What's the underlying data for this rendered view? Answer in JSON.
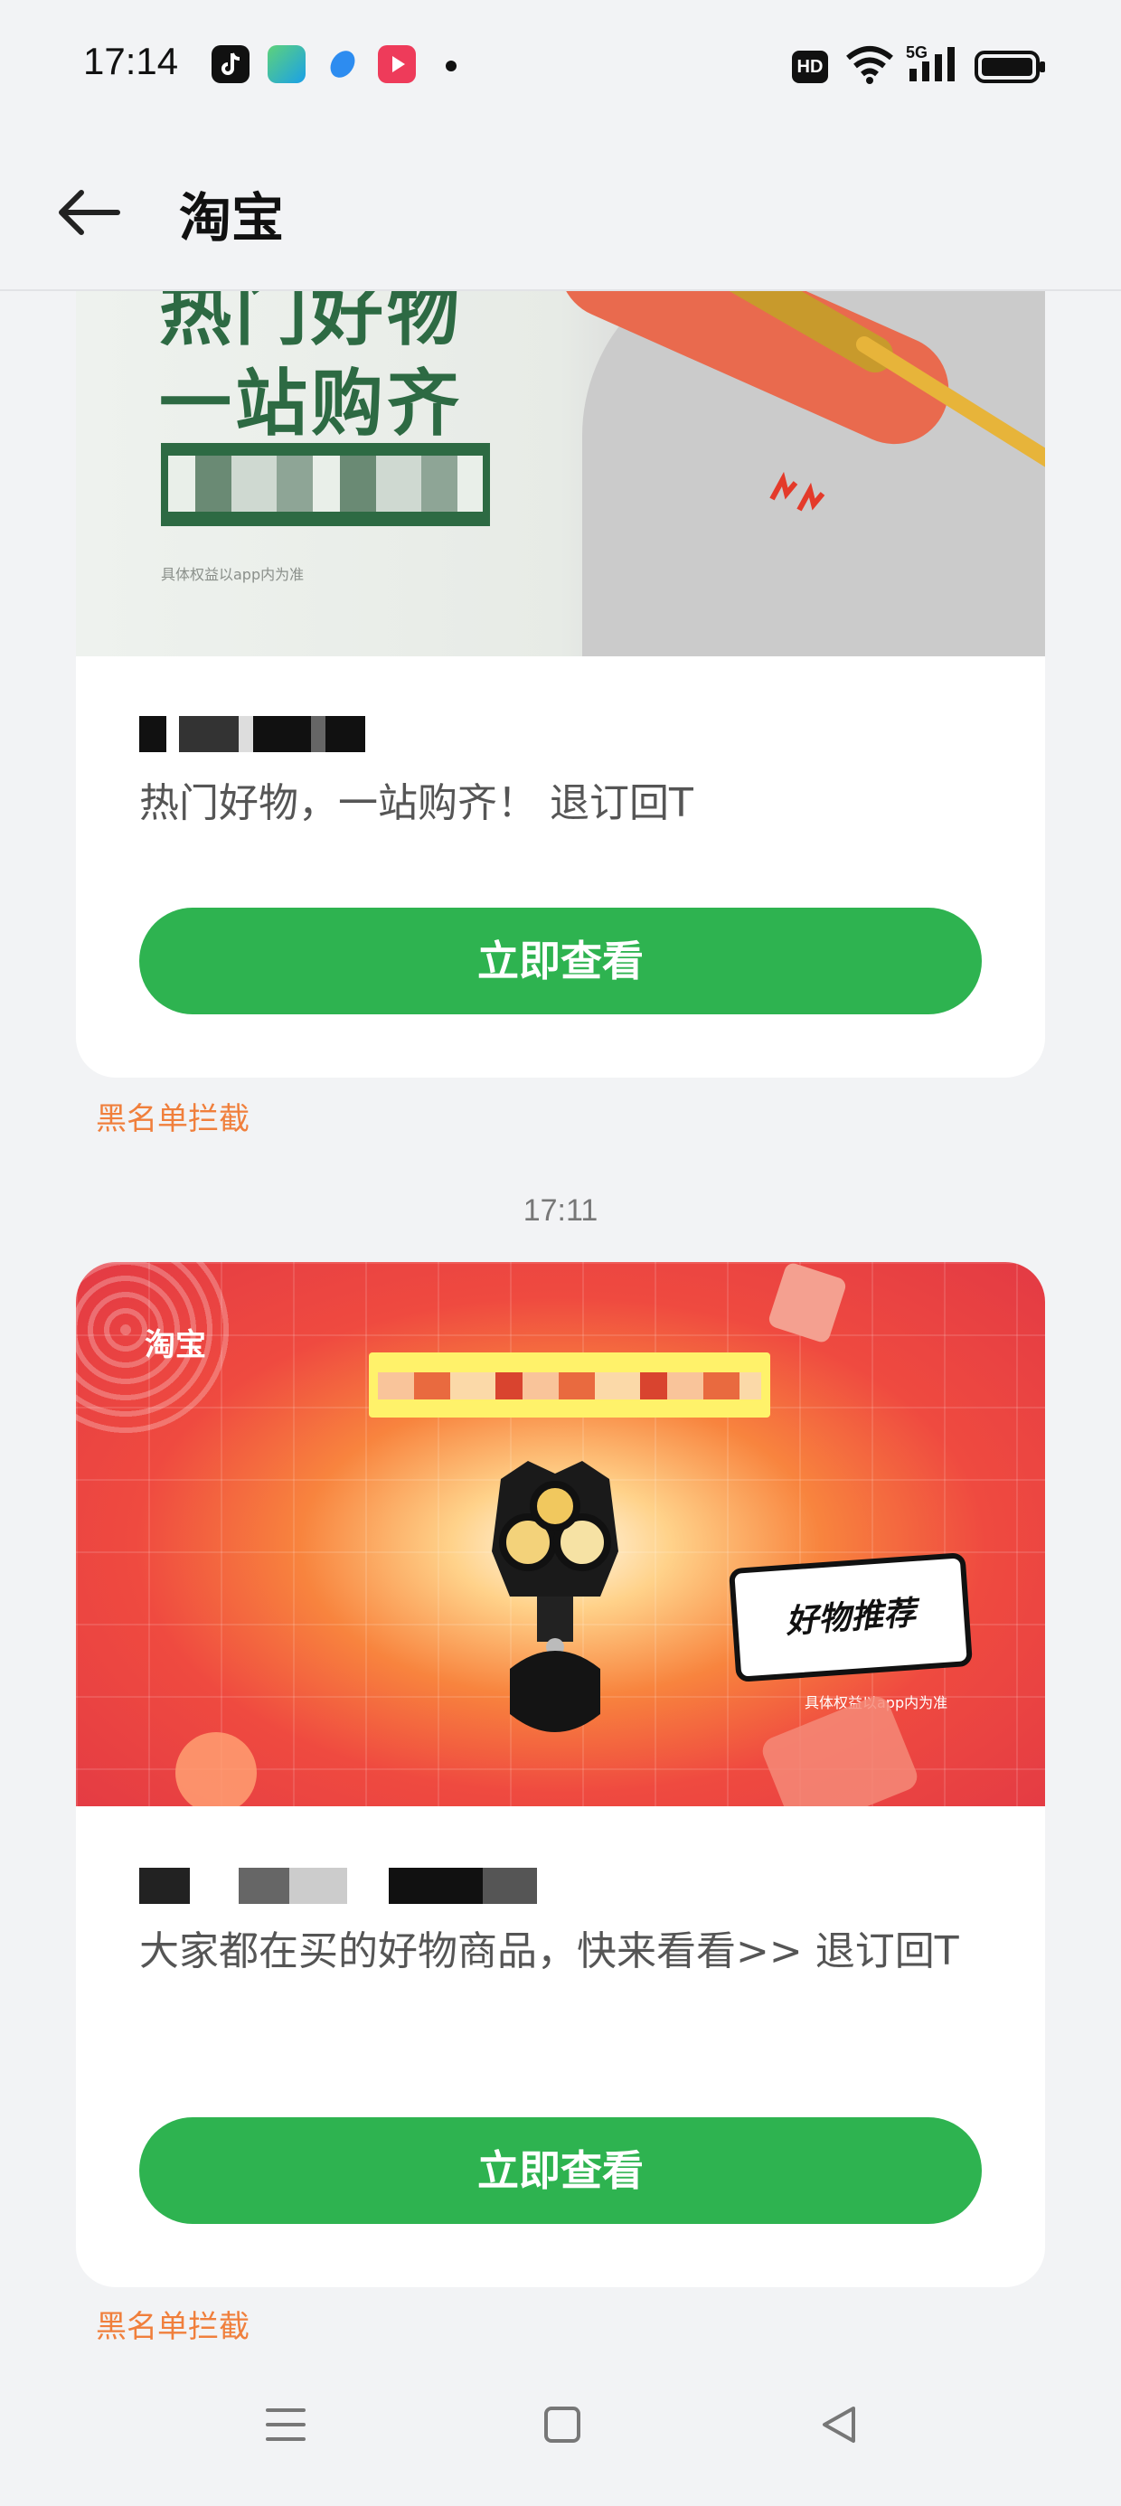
{
  "status_bar": {
    "time": "17:14",
    "hd_badge": "HD",
    "network": "5G",
    "app_icons": [
      "tiktok-icon",
      "app-store-icon",
      "blue-app-icon",
      "video-app-icon"
    ]
  },
  "header": {
    "title": "淘宝",
    "back_icon": "arrow-left-icon"
  },
  "messages": [
    {
      "banner": {
        "headline_line1": "热门好物",
        "headline_line2": "一站购齐",
        "fineprint": "具体权益以app内为准"
      },
      "body": "热门好物，一站购齐！ 退订回T",
      "button_label": "立即查看",
      "blacklist_label": "黑名单拦截"
    },
    {
      "timestamp": "17:11",
      "banner": {
        "logo": "淘宝",
        "badge": "好物推荐",
        "fineprint": "具体权益以app内为准"
      },
      "body": "大家都在买的好物商品，快来看看>> 退订回T",
      "button_label": "立即查看",
      "blacklist_label": "黑名单拦截"
    }
  ],
  "colors": {
    "accent_green": "#2eb350",
    "blacklist_orange": "#f07f3c",
    "background": "#f2f3f5"
  },
  "nav_bar": {
    "icons": [
      "menu-icon",
      "home-icon",
      "back-icon"
    ]
  }
}
